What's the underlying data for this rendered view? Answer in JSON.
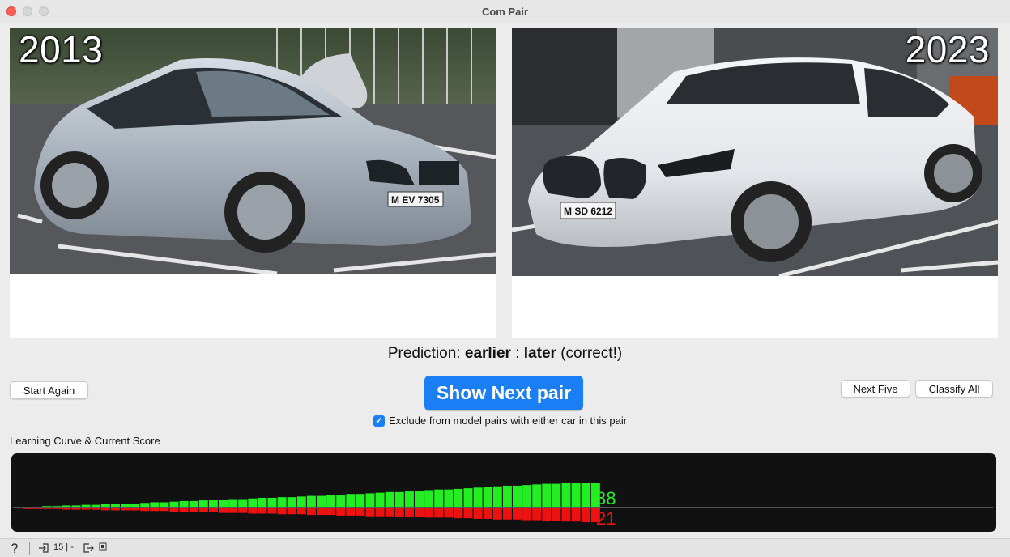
{
  "window": {
    "title": "Com Pair"
  },
  "left_panel": {
    "year": "2013",
    "plate": "M EV 7305"
  },
  "right_panel": {
    "year": "2023",
    "plate": "M SD 6212"
  },
  "prediction": {
    "label": "Prediction:",
    "left_word": "earlier",
    "separator": ":",
    "right_word": "later",
    "result": "(correct!)"
  },
  "buttons": {
    "start_again": "Start Again",
    "show_next": "Show Next pair",
    "next_five": "Next Five",
    "classify_all": "Classify All"
  },
  "exclude_checkbox": {
    "checked": true,
    "label": "Exclude from model pairs with either car in this pair"
  },
  "learning_curve": {
    "title": "Learning Curve & Current Score"
  },
  "chart_data": {
    "type": "bar",
    "colors": {
      "correct": "#22ee22",
      "wrong": "#ee1111",
      "background": "#111111"
    },
    "series": [
      {
        "name": "correct",
        "values": [
          0,
          0,
          1,
          1,
          2,
          2,
          3,
          3,
          4,
          4,
          5,
          5,
          6,
          7,
          7,
          8,
          9,
          9,
          10,
          11,
          11,
          12,
          12,
          13,
          14,
          14,
          15,
          15,
          16,
          17,
          17,
          18,
          19,
          20,
          20,
          21,
          22,
          23,
          23,
          24,
          25,
          26,
          27,
          27,
          28,
          29,
          30,
          31,
          32,
          33,
          33,
          34,
          35,
          36,
          36,
          37,
          37,
          38,
          38
        ]
      },
      {
        "name": "wrong",
        "values": [
          1,
          1,
          1,
          1,
          2,
          2,
          2,
          2,
          3,
          3,
          3,
          3,
          4,
          4,
          4,
          5,
          5,
          6,
          6,
          6,
          7,
          7,
          7,
          8,
          8,
          8,
          9,
          9,
          9,
          10,
          10,
          10,
          11,
          11,
          11,
          12,
          12,
          12,
          13,
          13,
          13,
          14,
          14,
          14,
          15,
          15,
          16,
          16,
          17,
          17,
          17,
          18,
          18,
          19,
          19,
          20,
          20,
          21,
          21
        ]
      }
    ],
    "score_correct": "38",
    "score_wrong": "21"
  },
  "status_bar": {
    "count": "15 | -"
  }
}
